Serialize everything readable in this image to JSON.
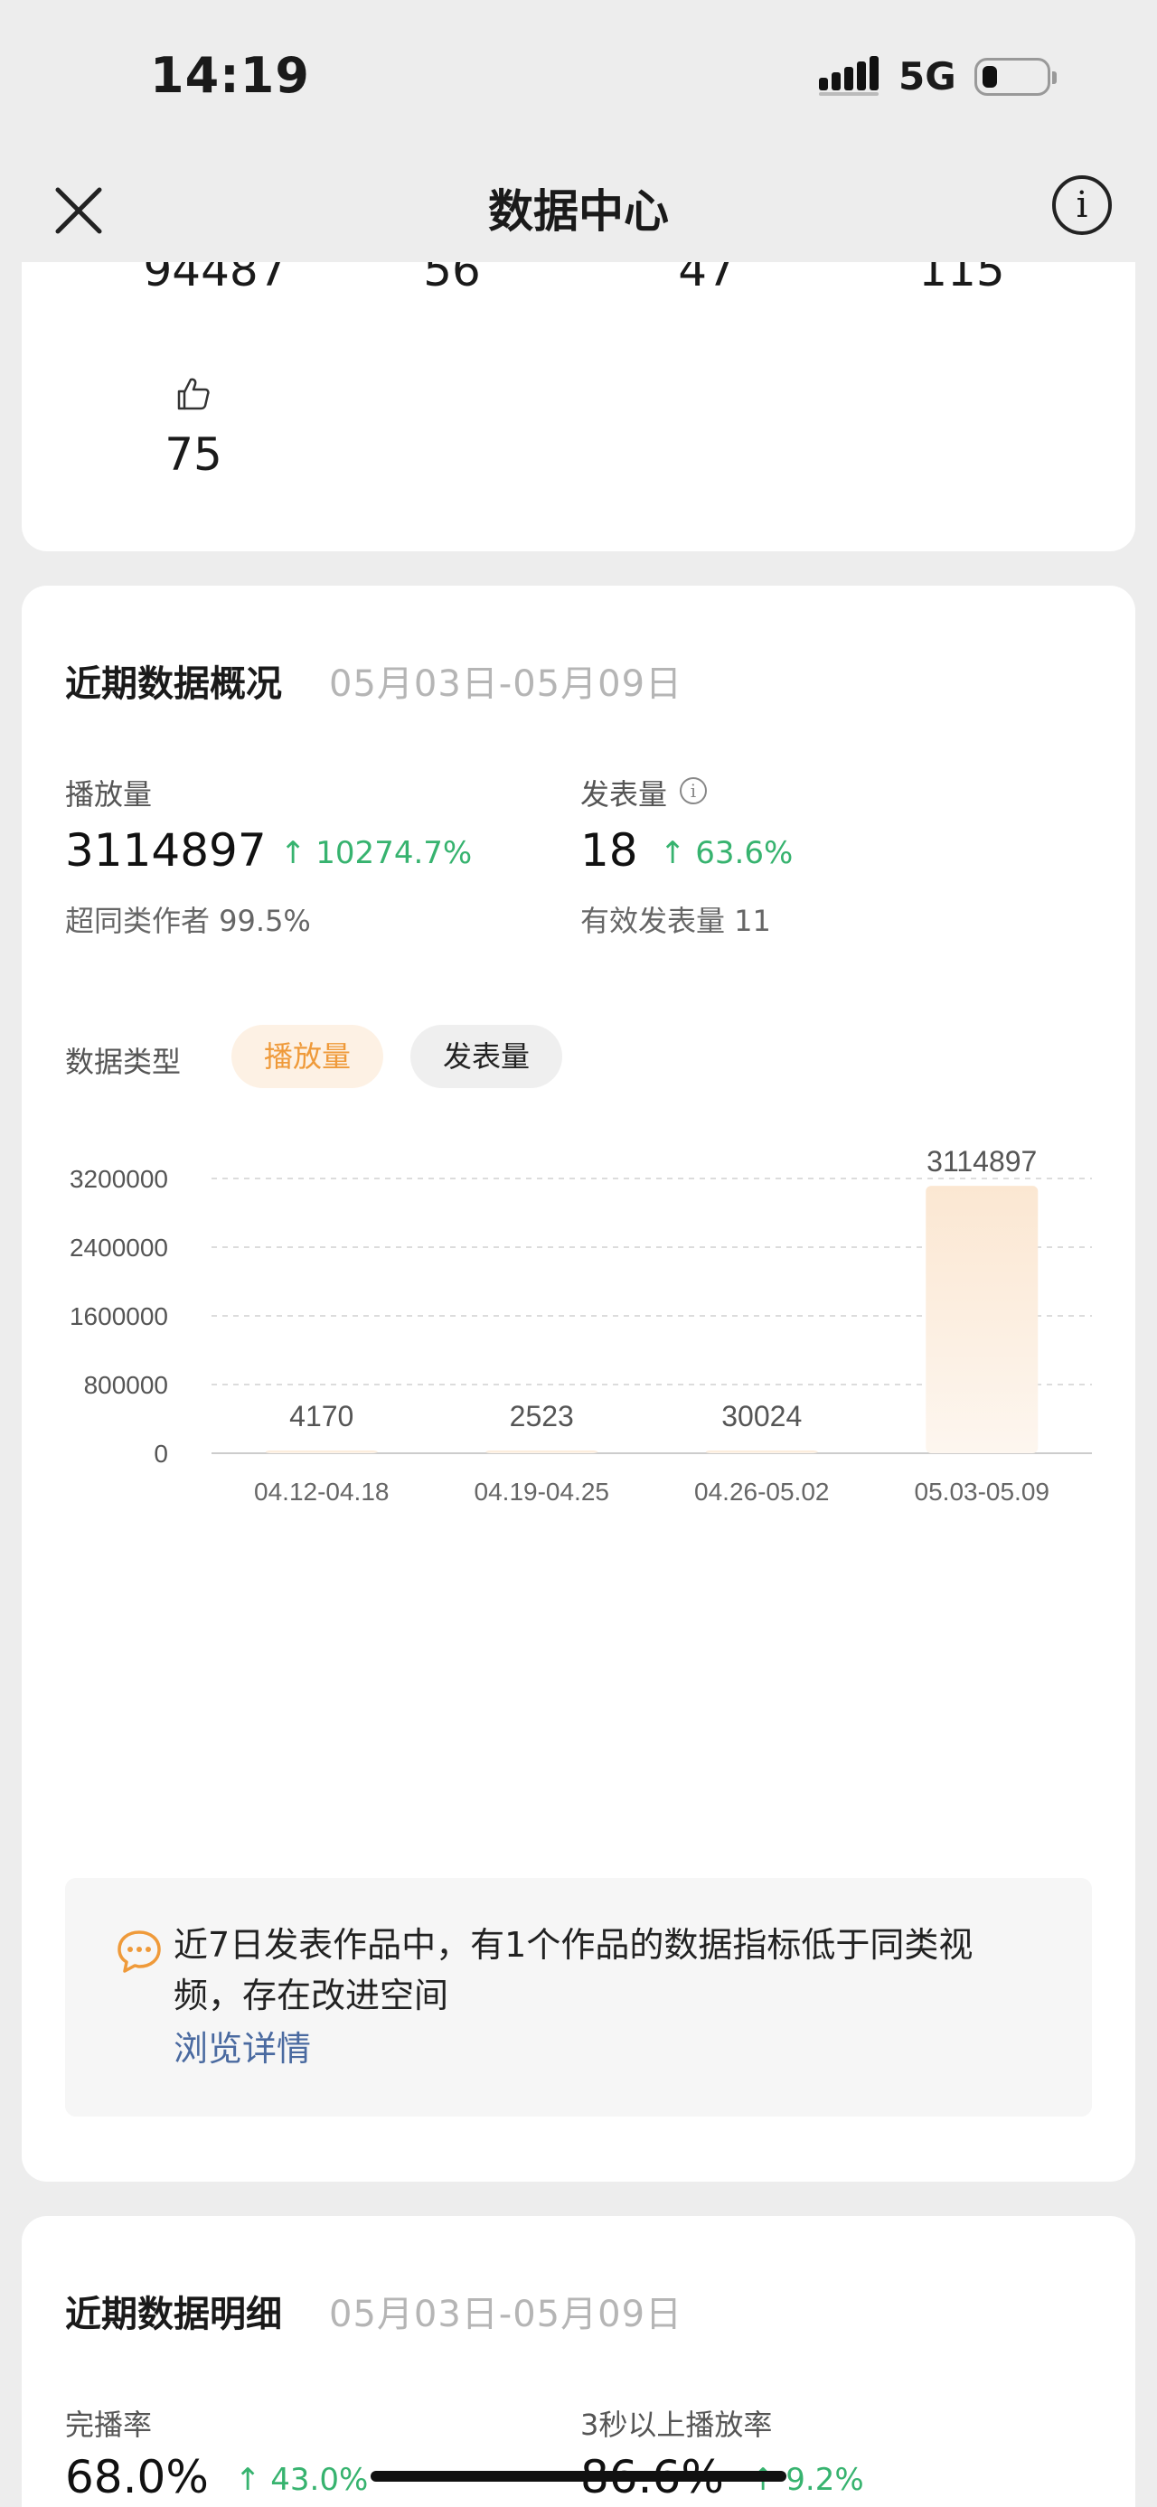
{
  "status_bar": {
    "time": "14:19",
    "network": "5G",
    "signal_icon": "signal-bars-icon",
    "battery_icon": "battery-low-icon"
  },
  "nav": {
    "title": "数据中心",
    "close_icon": "close-icon",
    "info_icon": "info-icon",
    "info_glyph": "i"
  },
  "top_stats": {
    "values": [
      "94487",
      "56",
      "47",
      "115"
    ],
    "like_icon": "thumbs-up-icon",
    "likes": "75"
  },
  "overview": {
    "title": "近期数据概况",
    "date_range": "05月03日-05月09日",
    "plays": {
      "label": "播放量",
      "value": "3114897",
      "trend": "↑ 10274.7%",
      "sub": "超同类作者 99.5%"
    },
    "posts": {
      "label": "发表量",
      "info_glyph": "i",
      "value": "18",
      "trend": "↑ 63.6%",
      "sub": "有效发表量 11"
    },
    "data_type_label": "数据类型",
    "chips": [
      "播放量",
      "发表量"
    ],
    "selected_chip": "播放量"
  },
  "chart_data": {
    "type": "bar",
    "categories": [
      "04.12-04.18",
      "04.19-04.25",
      "04.26-05.02",
      "05.03-05.09"
    ],
    "values": [
      4170,
      2523,
      30024,
      3114897
    ],
    "value_labels": [
      "4170",
      "2523",
      "30024",
      "3114897"
    ],
    "ylim": [
      0,
      3200000
    ],
    "yticks": [
      0,
      800000,
      1600000,
      2400000,
      3200000
    ],
    "ytick_labels": [
      "0",
      "800000",
      "1600000",
      "2400000",
      "3200000"
    ],
    "grid": true,
    "bar_color": "#fbe9d6",
    "xlabel": "",
    "ylabel": ""
  },
  "tip": {
    "icon": "chat-bubble-icon",
    "text": "近7日发表作品中，有1个作品的数据指标低于同类视频，存在改进空间",
    "link": "浏览详情"
  },
  "detail": {
    "title": "近期数据明细",
    "date_range": "05月03日-05月09日",
    "completion": {
      "label": "完播率",
      "value": "68.0%",
      "trend": "↑ 43.0%"
    },
    "three_sec": {
      "label": "3秒以上播放率",
      "value": "86.6%",
      "trend": "↑ 9.2%"
    }
  },
  "colors": {
    "accent": "#ef9a3a",
    "trend_up": "#37b36f",
    "link": "#4a6aa0"
  }
}
